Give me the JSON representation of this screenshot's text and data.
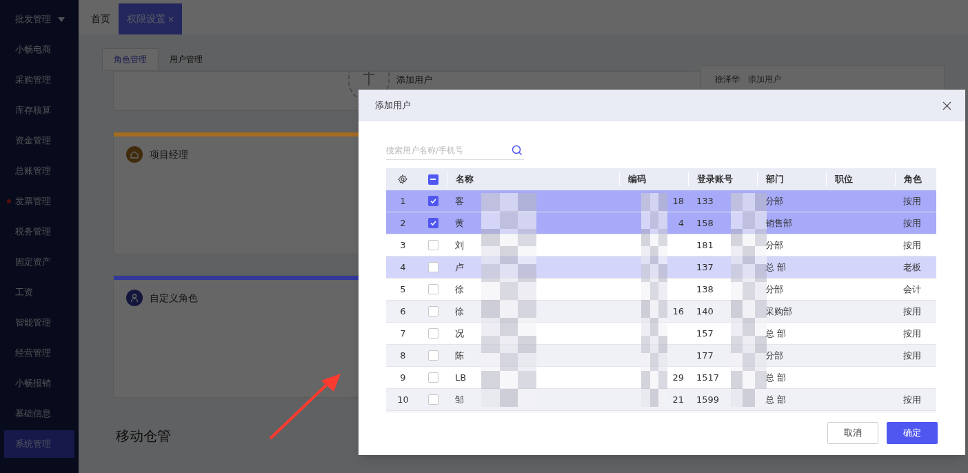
{
  "sidebar": {
    "items": [
      {
        "label": "批发管理",
        "selected": false,
        "dot": false,
        "expandable": true
      },
      {
        "label": "小畅电商",
        "selected": false,
        "dot": false,
        "expandable": false
      },
      {
        "label": "采购管理",
        "selected": false,
        "dot": false,
        "expandable": false
      },
      {
        "label": "库存核算",
        "selected": false,
        "dot": false,
        "expandable": false
      },
      {
        "label": "资金管理",
        "selected": false,
        "dot": false,
        "expandable": false
      },
      {
        "label": "总账管理",
        "selected": false,
        "dot": false,
        "expandable": false
      },
      {
        "label": "发票管理",
        "selected": false,
        "dot": true,
        "expandable": false
      },
      {
        "label": "税务管理",
        "selected": false,
        "dot": false,
        "expandable": false
      },
      {
        "label": "固定资产",
        "selected": false,
        "dot": false,
        "expandable": false
      },
      {
        "label": "工资",
        "selected": false,
        "dot": false,
        "expandable": false
      },
      {
        "label": "智能管理",
        "selected": false,
        "dot": false,
        "expandable": false
      },
      {
        "label": "经营管理",
        "selected": false,
        "dot": false,
        "expandable": false
      },
      {
        "label": "小畅报销",
        "selected": false,
        "dot": false,
        "expandable": false
      },
      {
        "label": "基础信息",
        "selected": false,
        "dot": false,
        "expandable": false
      },
      {
        "label": "系统管理",
        "selected": true,
        "dot": false,
        "expandable": false
      }
    ]
  },
  "top_tabs": [
    {
      "label": "首页",
      "selected": false,
      "closable": false
    },
    {
      "label": "权限设置",
      "selected": true,
      "closable": true
    }
  ],
  "sub_tabs": [
    {
      "label": "角色管理",
      "selected": true
    },
    {
      "label": "用户管理",
      "selected": false
    }
  ],
  "background": {
    "add_user_label": "添加用户",
    "role_cards": [
      {
        "title": "项目经理",
        "color": "#a26c22",
        "kind": "house"
      },
      {
        "title": "自定义角色",
        "color": "#33389a",
        "kind": "person"
      }
    ],
    "section_heading": "移动仓管",
    "side_user": "徐泽华",
    "side_add_user": "添加用户"
  },
  "dialog": {
    "title": "添加用户",
    "search": {
      "placeholder": "搜索用户名称/手机号"
    },
    "columns": [
      "名称",
      "编码",
      "登录账号",
      "部门",
      "职位",
      "角色"
    ],
    "header_checkbox": {
      "indeterminate": true
    },
    "rows": [
      {
        "no": "1",
        "checked": true,
        "hovered": false,
        "name": "客",
        "code": "18",
        "account": "133",
        "dept": "分部",
        "role": "按用"
      },
      {
        "no": "2",
        "checked": true,
        "hovered": false,
        "name": "黄",
        "code": "4",
        "account": "158",
        "dept": "销售部",
        "role": "按用"
      },
      {
        "no": "3",
        "checked": false,
        "hovered": false,
        "name": "刘",
        "account": "181",
        "dept": "分部",
        "role": "按用"
      },
      {
        "no": "4",
        "checked": false,
        "hovered": true,
        "name": "卢",
        "account": "137",
        "dept": "总 部",
        "role": "老板"
      },
      {
        "no": "5",
        "checked": false,
        "hovered": false,
        "name": "徐",
        "account": "138",
        "dept": "分部",
        "role": "会计"
      },
      {
        "no": "6",
        "checked": false,
        "hovered": false,
        "name": "徐",
        "code": "16",
        "account": "140",
        "dept": "采购部",
        "role": "按用"
      },
      {
        "no": "7",
        "checked": false,
        "hovered": false,
        "name": "况",
        "account": "157",
        "dept": "总 部",
        "role": "按用"
      },
      {
        "no": "8",
        "checked": false,
        "hovered": false,
        "name": "陈",
        "account": "177",
        "dept": "分部",
        "role": "按用"
      },
      {
        "no": "9",
        "checked": false,
        "hovered": false,
        "name": "LB",
        "code": "29",
        "account": "1517",
        "dept": "总 部"
      },
      {
        "no": "10",
        "checked": false,
        "hovered": false,
        "name": "邹",
        "code": "21",
        "account": "1599",
        "dept": "总 部",
        "role": "按用"
      }
    ],
    "buttons": [
      {
        "label": "取消",
        "kind": "secondary"
      },
      {
        "label": "确定",
        "kind": "primary"
      }
    ]
  }
}
